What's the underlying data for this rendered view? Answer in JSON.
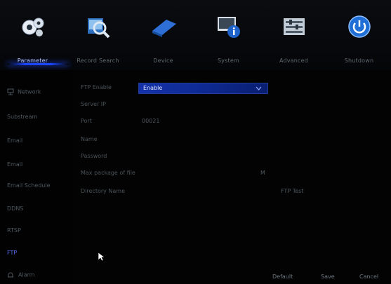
{
  "top_nav": [
    {
      "label": "Parameter",
      "icon": "gears-icon"
    },
    {
      "label": "Record Search",
      "icon": "search-record-icon"
    },
    {
      "label": "Device",
      "icon": "device-icon"
    },
    {
      "label": "System",
      "icon": "system-info-icon"
    },
    {
      "label": "Advanced",
      "icon": "advanced-icon"
    },
    {
      "label": "Shutdown",
      "icon": "power-icon"
    }
  ],
  "sidebar": {
    "items": [
      "Network",
      "Network",
      "Substream",
      "Email",
      "Email",
      "Email Schedule",
      "DDNS",
      "RTSP",
      "FTP"
    ],
    "display_items": [
      {
        "label": "Network"
      },
      {
        "label": "Substream"
      },
      {
        "label": "Email"
      },
      {
        "label": "Email Schedule"
      },
      {
        "label": "DDNS"
      },
      {
        "label": "RTSP"
      },
      {
        "label": "FTP"
      }
    ],
    "active_label": "FTP",
    "section_top": "Network",
    "alarm_label": "Alarm"
  },
  "form": {
    "enable_label": "FTP Enable",
    "enable_value": "Enable",
    "server_ip_label": "Server IP",
    "port_label": "Port",
    "port_value": "00021",
    "name_label": "Name",
    "password_label": "Password",
    "max_package_label": "Max package of file",
    "max_package_unit": "M",
    "directory_label": "Directory Name",
    "directory_value": "FTP Test"
  },
  "footer": {
    "default_label": "Default",
    "save_label": "Save",
    "cancel_label": "Cancel"
  },
  "colors": {
    "accent": "#1b45ff",
    "background": "#030303"
  }
}
